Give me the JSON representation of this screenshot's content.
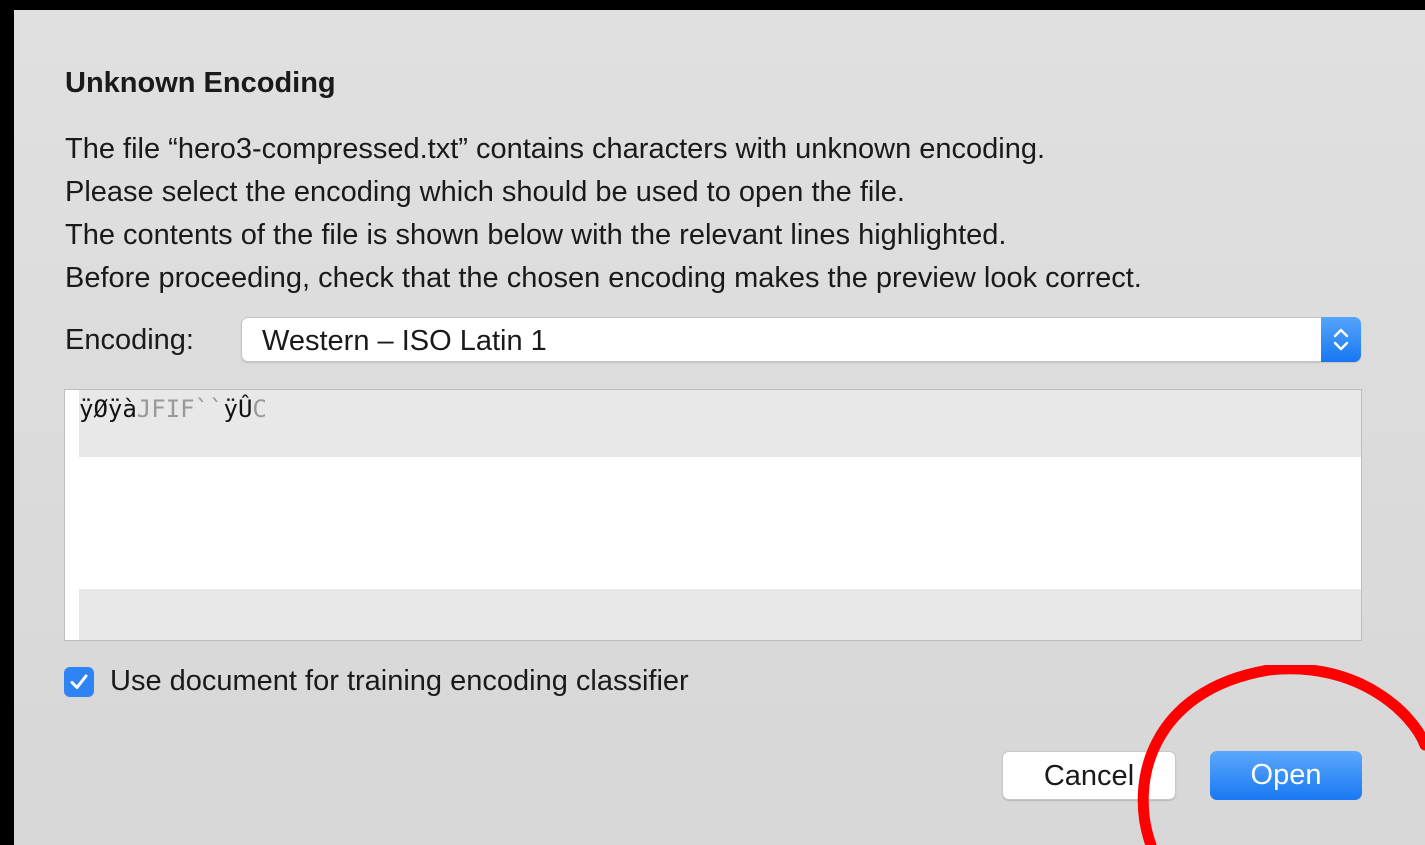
{
  "dialog": {
    "title": "Unknown Encoding",
    "message_lines": [
      "The file “hero3-compressed.txt” contains characters with unknown encoding.",
      "Please select the encoding which should be used to open the file.",
      "The contents of the file is shown below with the relevant lines highlighted.",
      "Before proceeding, check that the chosen encoding makes the preview look correct."
    ],
    "encoding_label": "Encoding:",
    "encoding_value": "Western – ISO Latin 1",
    "preview": {
      "segments": [
        "ÿØÿà",
        "JFIF``",
        "ÿÛ",
        "C"
      ]
    },
    "checkbox_label": "Use document for training encoding classifier",
    "checkbox_checked": true,
    "cancel_label": "Cancel",
    "open_label": "Open"
  },
  "colors": {
    "accent": "#1a78f3",
    "annotation": "#ff0000"
  }
}
